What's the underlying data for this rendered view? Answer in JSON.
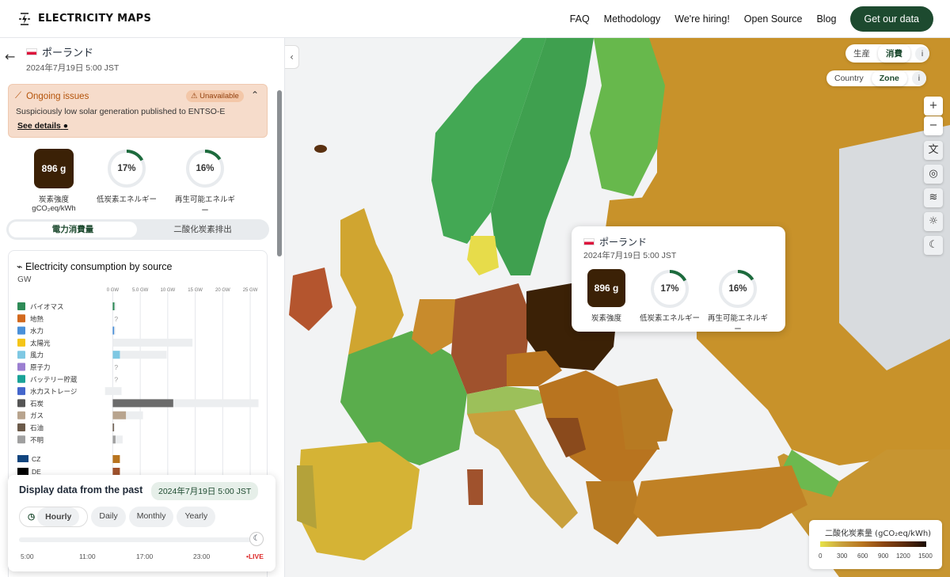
{
  "nav": {
    "logo": "ELECTRICITY MAPS",
    "links": [
      "FAQ",
      "Methodology",
      "We're hiring!",
      "Open Source",
      "Blog"
    ],
    "cta": "Get our data"
  },
  "zone": {
    "name": "ポーランド",
    "datetime": "2024年7月19日 5:00 JST"
  },
  "issue": {
    "title": "Ongoing issues",
    "badge": "Unavailable",
    "text": "Suspiciously low solar generation published to ENTSO-E",
    "link": "See details"
  },
  "kpis": {
    "carbon_value": "896 g",
    "carbon_label": "炭素強度",
    "carbon_unit": "gCO₂eq/kWh",
    "lowcarbon_value": "17%",
    "lowcarbon_label": "低炭素エネルギー",
    "renewable_value": "16%",
    "renewable_label": "再生可能エネルギー",
    "lowcarbon_fraction": 0.17,
    "renewable_fraction": 0.16
  },
  "toggle": {
    "active": "電力消費量",
    "inactive": "二酸化炭素排出"
  },
  "chart": {
    "title": "Electricity consumption by source",
    "unit": "GW"
  },
  "chart_data": {
    "type": "bar",
    "title": "Electricity consumption by source",
    "ylabel": "GW",
    "xlim": [
      -1.5,
      26
    ],
    "ticks": [
      "0 GW",
      "5.0 GW",
      "10 GW",
      "15 GW",
      "20 GW",
      "25 GW"
    ],
    "tick_values": [
      0,
      5,
      10,
      15,
      20,
      25
    ],
    "categories": [
      "バイオマス",
      "地熱",
      "水力",
      "太陽光",
      "風力",
      "原子力",
      "バッテリー貯蔵",
      "水力ストレージ",
      "石炭",
      "ガス",
      "石油",
      "不明"
    ],
    "values": [
      0.3,
      null,
      0.25,
      0,
      1.3,
      null,
      null,
      0,
      11,
      2.4,
      0.2,
      0.5
    ],
    "capacity": [
      0.6,
      0,
      0.5,
      14.5,
      9.8,
      0,
      0,
      1.6,
      26.5,
      5.5,
      0.4,
      1.8
    ],
    "storage_discharge_min": -1.4,
    "colors": [
      "#2e8b57",
      "#d2691e",
      "#4a90d9",
      "#f5c518",
      "#7ec8e3",
      "#9b7fd1",
      "#1aa398",
      "#4466cc",
      "#555555",
      "#b8a48e",
      "#6b5a4a",
      "#a0a0a0"
    ],
    "unavailable_label": "?",
    "exchanges": [
      "CZ",
      "DE"
    ],
    "exchange_colors": [
      "#b8741f",
      "#a0522d"
    ]
  },
  "past": {
    "title": "Display data from the past",
    "datetime": "2024年7月19日 5:00 JST",
    "tabs": [
      "Hourly",
      "Daily",
      "Monthly",
      "Yearly"
    ],
    "ticks": [
      "5:00",
      "11:00",
      "17:00",
      "23:00"
    ],
    "live": "•LIVE"
  },
  "mapcontrols": {
    "mode": [
      "生産",
      "消費"
    ],
    "mode_active": "消費",
    "level": [
      "Country",
      "Zone"
    ],
    "level_active": "Zone",
    "info": "i"
  },
  "tooltip": {
    "name": "ポーランド",
    "datetime": "2024年7月19日 5:00 JST",
    "carbon_value": "896 g",
    "carbon_label": "炭素強度",
    "lowcarbon_value": "17%",
    "lowcarbon_label": "低炭素エネルギー",
    "renewable_value": "16%",
    "renewable_label": "再生可能エネルギー"
  },
  "legend": {
    "title": "二酸化炭素量 (gCO₂eq/kWh)",
    "ticks": [
      "0",
      "300",
      "600",
      "900",
      "1200",
      "1500"
    ]
  },
  "colors": {
    "accent": "#1d4a2f",
    "carbon_box": "#3b2106",
    "issue_bg": "#f6dccb"
  }
}
